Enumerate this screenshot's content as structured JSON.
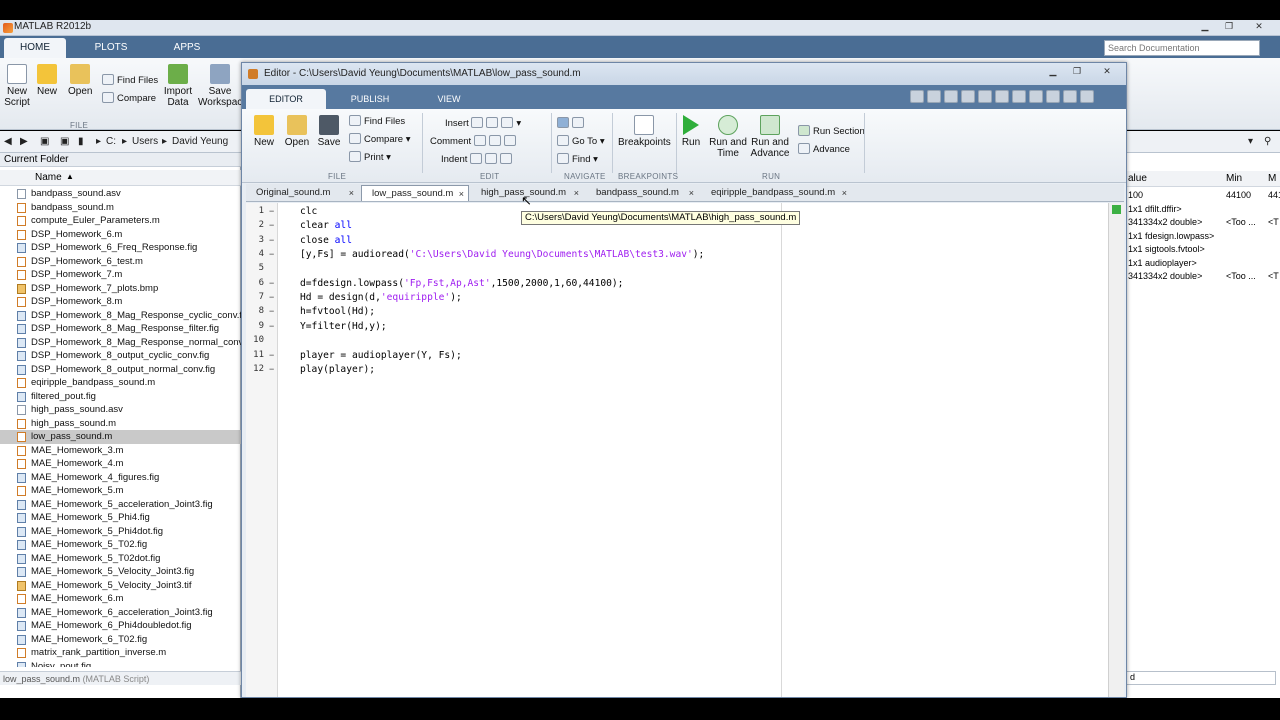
{
  "main_window": {
    "title": "MATLAB R2012b",
    "tabs": [
      "HOME",
      "PLOTS",
      "APPS"
    ],
    "search_placeholder": "Search Documentation",
    "home_tools": {
      "new_script": "New\nScript",
      "new": "New",
      "open": "Open",
      "find_files": "Find Files",
      "compare": "Compare",
      "import_data": "Import\nData",
      "save_workspace": "Save\nWorkspace",
      "file_section": "FILE"
    },
    "address": {
      "drive": "C:",
      "users": "Users",
      "user": "David Yeung"
    }
  },
  "current_folder": {
    "title": "Current Folder",
    "column_name": "Name",
    "files": [
      {
        "name": "bandpass_sound.asv",
        "type": "asv"
      },
      {
        "name": "bandpass_sound.m",
        "type": "m"
      },
      {
        "name": "compute_Euler_Parameters.m",
        "type": "m"
      },
      {
        "name": "DSP_Homework_6.m",
        "type": "m"
      },
      {
        "name": "DSP_Homework_6_Freq_Response.fig",
        "type": "fig"
      },
      {
        "name": "DSP_Homework_6_test.m",
        "type": "m"
      },
      {
        "name": "DSP_Homework_7.m",
        "type": "m"
      },
      {
        "name": "DSP_Homework_7_plots.bmp",
        "type": "bmp"
      },
      {
        "name": "DSP_Homework_8.m",
        "type": "m"
      },
      {
        "name": "DSP_Homework_8_Mag_Response_cyclic_conv.fig",
        "type": "fig"
      },
      {
        "name": "DSP_Homework_8_Mag_Response_filter.fig",
        "type": "fig"
      },
      {
        "name": "DSP_Homework_8_Mag_Response_normal_conv.fig",
        "type": "fig"
      },
      {
        "name": "DSP_Homework_8_output_cyclic_conv.fig",
        "type": "fig"
      },
      {
        "name": "DSP_Homework_8_output_normal_conv.fig",
        "type": "fig"
      },
      {
        "name": "eqiripple_bandpass_sound.m",
        "type": "m"
      },
      {
        "name": "filtered_pout.fig",
        "type": "fig"
      },
      {
        "name": "high_pass_sound.asv",
        "type": "asv"
      },
      {
        "name": "high_pass_sound.m",
        "type": "m"
      },
      {
        "name": "low_pass_sound.m",
        "type": "m",
        "selected": true
      },
      {
        "name": "MAE_Homework_3.m",
        "type": "m"
      },
      {
        "name": "MAE_Homework_4.m",
        "type": "m"
      },
      {
        "name": "MAE_Homework_4_figures.fig",
        "type": "fig"
      },
      {
        "name": "MAE_Homework_5.m",
        "type": "m"
      },
      {
        "name": "MAE_Homework_5_acceleration_Joint3.fig",
        "type": "fig"
      },
      {
        "name": "MAE_Homework_5_Phi4.fig",
        "type": "fig"
      },
      {
        "name": "MAE_Homework_5_Phi4dot.fig",
        "type": "fig"
      },
      {
        "name": "MAE_Homework_5_T02.fig",
        "type": "fig"
      },
      {
        "name": "MAE_Homework_5_T02dot.fig",
        "type": "fig"
      },
      {
        "name": "MAE_Homework_5_Velocity_Joint3.fig",
        "type": "fig"
      },
      {
        "name": "MAE_Homework_5_Velocity_Joint3.tif",
        "type": "bmp"
      },
      {
        "name": "MAE_Homework_6.m",
        "type": "m"
      },
      {
        "name": "MAE_Homework_6_acceleration_Joint3.fig",
        "type": "fig"
      },
      {
        "name": "MAE_Homework_6_Phi4doubledot.fig",
        "type": "fig"
      },
      {
        "name": "MAE_Homework_6_T02.fig",
        "type": "fig"
      },
      {
        "name": "matrix_rank_partition_inverse.m",
        "type": "m"
      },
      {
        "name": "Noisy_pout.fig",
        "type": "fig"
      }
    ],
    "status_name": "low_pass_sound.m",
    "status_type": "(MATLAB Script)"
  },
  "workspace": {
    "col_value": "alue",
    "col_min": "Min",
    "col_max": "M",
    "rows": [
      {
        "value": "100",
        "min": "44100",
        "max": "441"
      },
      {
        "value": "1x1 dfilt.dffir>",
        "min": "",
        "max": ""
      },
      {
        "value": "341334x2 double>",
        "min": "<Too ...",
        "max": "<T"
      },
      {
        "value": "1x1 fdesign.lowpass>",
        "min": "",
        "max": ""
      },
      {
        "value": "1x1 sigtools.fvtool>",
        "min": "",
        "max": ""
      },
      {
        "value": "1x1 audioplayer>",
        "min": "",
        "max": ""
      },
      {
        "value": "341334x2 double>",
        "min": "<Too ...",
        "max": "<T"
      }
    ],
    "bottom_text": "d"
  },
  "editor": {
    "title": "Editor - C:\\Users\\David Yeung\\Documents\\MATLAB\\low_pass_sound.m",
    "tabs": [
      "EDITOR",
      "PUBLISH",
      "VIEW"
    ],
    "tools": {
      "new": "New",
      "open": "Open",
      "save": "Save",
      "find_files": "Find Files",
      "compare": "Compare",
      "print": "Print",
      "insert": "Insert",
      "comment": "Comment",
      "indent": "Indent",
      "go_to": "Go To",
      "find": "Find",
      "breakpoints": "Breakpoints",
      "run": "Run",
      "run_and_time": "Run and\nTime",
      "run_and_advance": "Run and\nAdvance",
      "run_section": "Run Section",
      "advance": "Advance",
      "sections": [
        "FILE",
        "EDIT",
        "NAVIGATE",
        "BREAKPOINTS",
        "RUN"
      ]
    },
    "file_tabs": [
      {
        "name": "Original_sound.m",
        "active": false
      },
      {
        "name": "low_pass_sound.m",
        "active": true
      },
      {
        "name": "high_pass_sound.m",
        "active": false
      },
      {
        "name": "bandpass_sound.m",
        "active": false
      },
      {
        "name": "eqiripple_bandpass_sound.m",
        "active": false
      }
    ],
    "tooltip": "C:\\Users\\David Yeung\\Documents\\MATLAB\\high_pass_sound.m",
    "code_lines": [
      {
        "n": "1",
        "dash": "−",
        "parts": [
          [
            "clc",
            ""
          ]
        ]
      },
      {
        "n": "2",
        "dash": "−",
        "parts": [
          [
            "clear ",
            ""
          ],
          [
            "all",
            "kw"
          ]
        ]
      },
      {
        "n": "3",
        "dash": "−",
        "parts": [
          [
            "close ",
            ""
          ],
          [
            "all",
            "kw"
          ]
        ]
      },
      {
        "n": "4",
        "dash": "−",
        "parts": [
          [
            "[y,Fs] = audioread(",
            ""
          ],
          [
            "'C:\\Users\\David Yeung\\Documents\\MATLAB\\test3.wav'",
            "str"
          ],
          [
            ");",
            ""
          ]
        ]
      },
      {
        "n": "5",
        "dash": "",
        "parts": []
      },
      {
        "n": "6",
        "dash": "−",
        "parts": [
          [
            "d=fdesign.lowpass(",
            ""
          ],
          [
            "'Fp,Fst,Ap,Ast'",
            "str"
          ],
          [
            ",1500,2000,1,60,44100);",
            ""
          ]
        ]
      },
      {
        "n": "7",
        "dash": "−",
        "parts": [
          [
            "Hd = design(d,",
            ""
          ],
          [
            "'equiripple'",
            "str"
          ],
          [
            ");",
            ""
          ]
        ]
      },
      {
        "n": "8",
        "dash": "−",
        "parts": [
          [
            "h=fvtool(Hd);",
            ""
          ]
        ]
      },
      {
        "n": "9",
        "dash": "−",
        "parts": [
          [
            "Y=filter(Hd,y);",
            ""
          ]
        ]
      },
      {
        "n": "10",
        "dash": "",
        "parts": []
      },
      {
        "n": "11",
        "dash": "−",
        "parts": [
          [
            "player = audioplayer(Y, Fs);",
            ""
          ]
        ]
      },
      {
        "n": "12",
        "dash": "−",
        "parts": [
          [
            "play(player);",
            ""
          ]
        ]
      }
    ]
  },
  "colors": {
    "tab_bar": "#4a6d94",
    "keyword": "#0000ff",
    "string": "#a020f0",
    "selection": "#c9c9c9"
  }
}
